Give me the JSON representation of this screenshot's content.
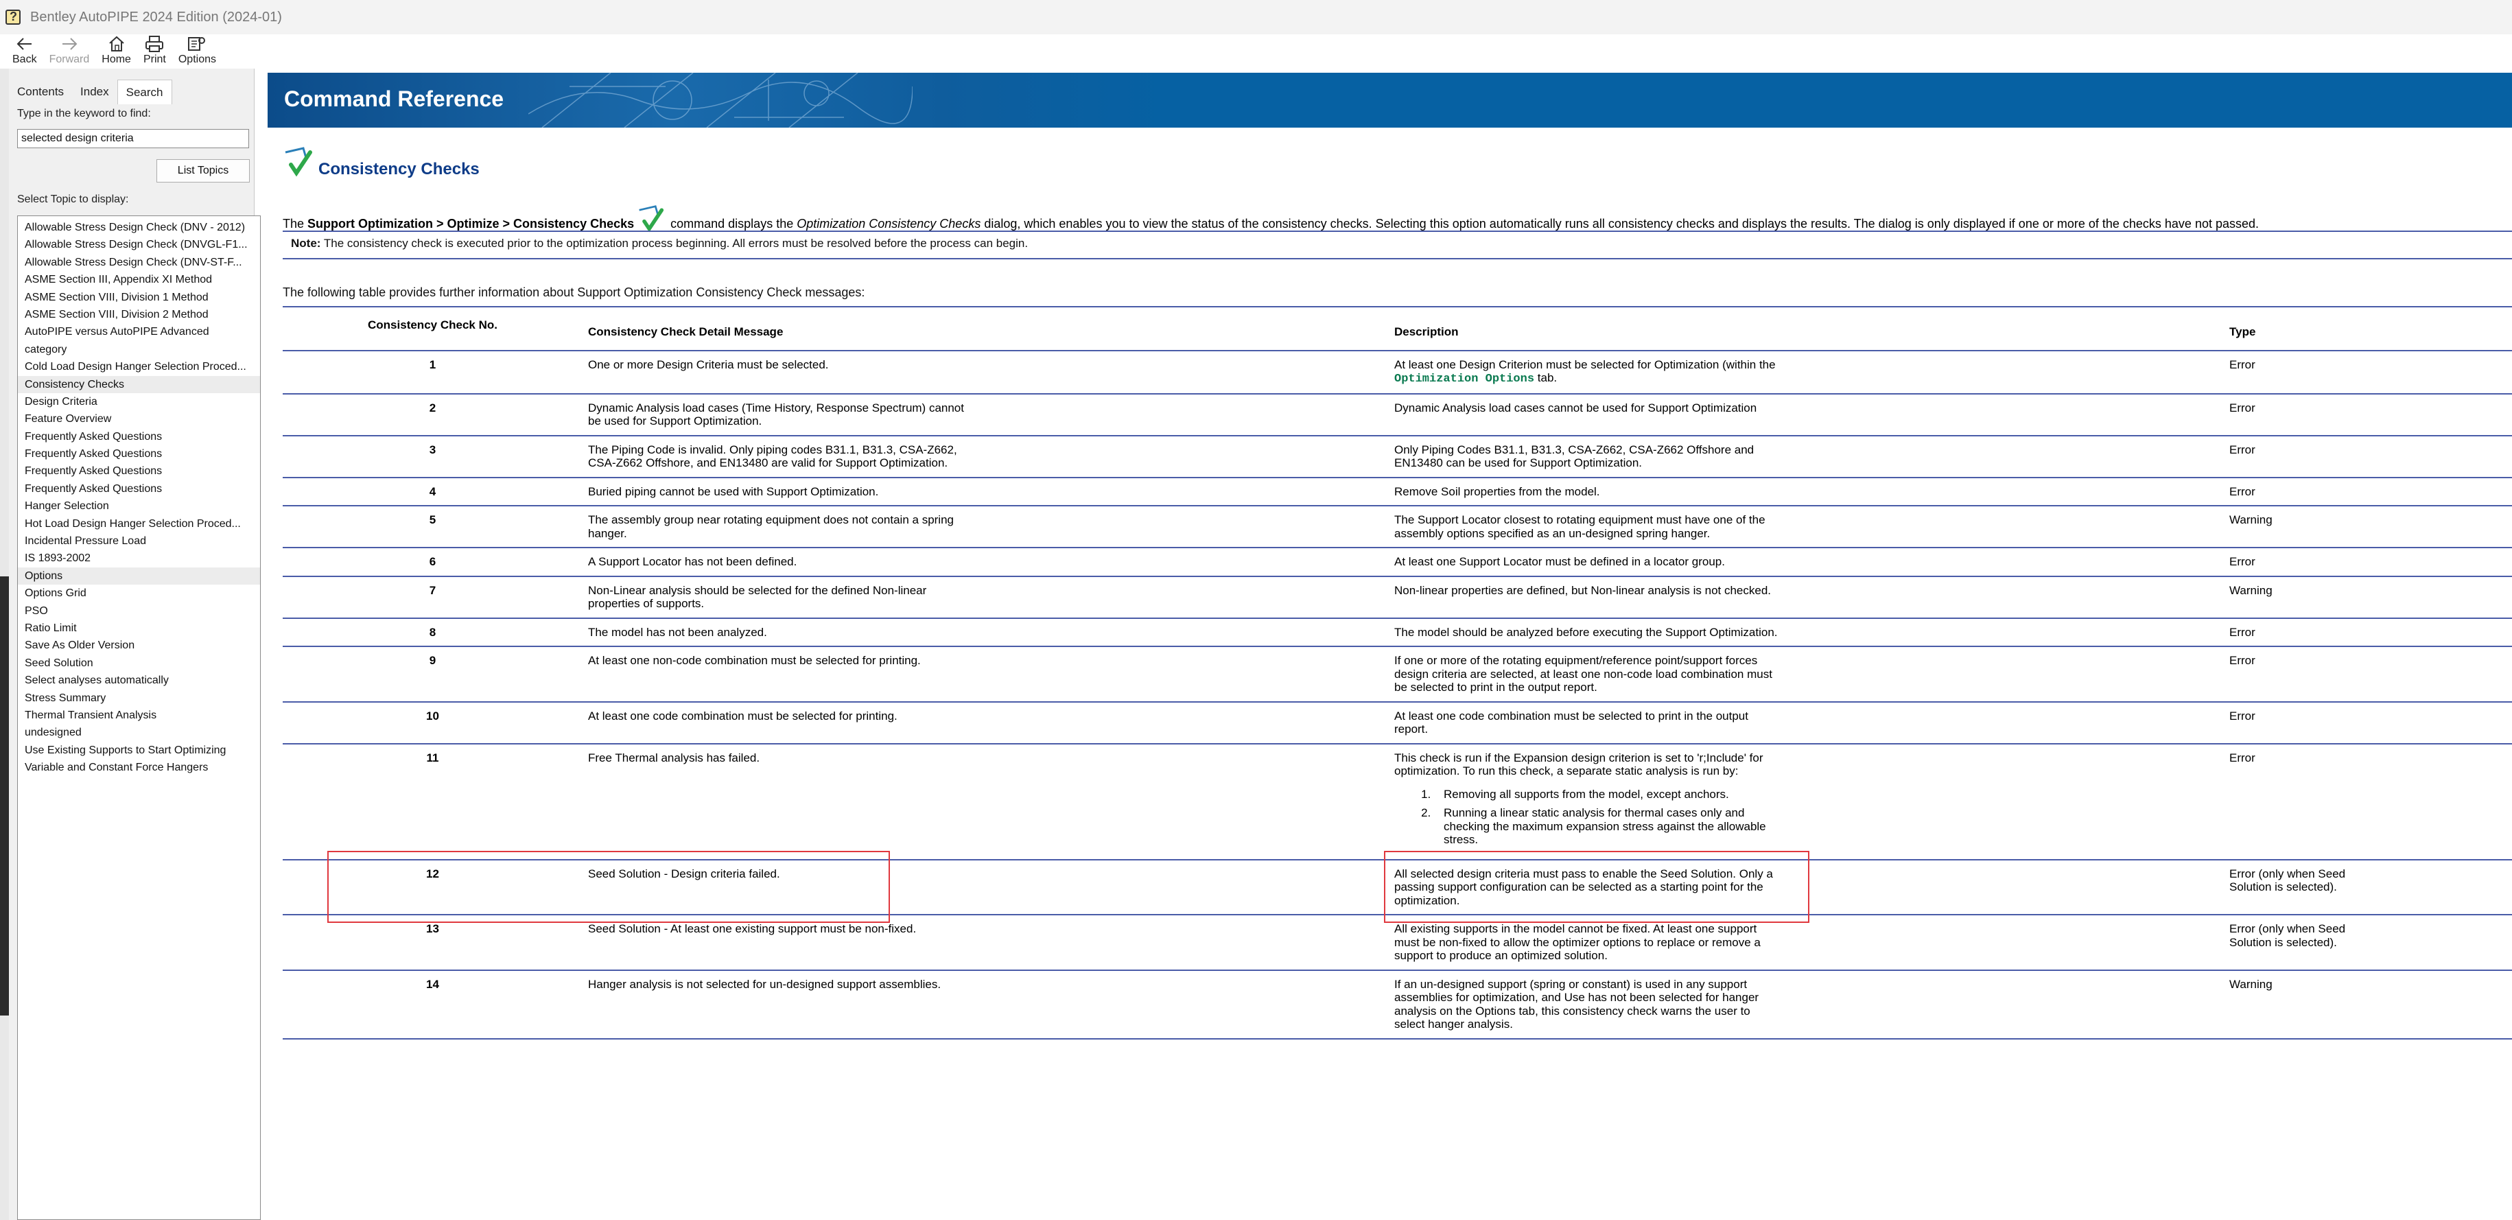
{
  "window": {
    "title": "Bentley AutoPIPE 2024 Edition (2024-01)",
    "icon": "help-book-icon"
  },
  "toolbar": {
    "buttons": [
      {
        "label": "Back",
        "icon": "back-arrow-icon",
        "enabled": true
      },
      {
        "label": "Forward",
        "icon": "forward-arrow-icon",
        "enabled": false
      },
      {
        "label": "Home",
        "icon": "home-icon",
        "enabled": true
      },
      {
        "label": "Print",
        "icon": "printer-icon",
        "enabled": true
      },
      {
        "label": "Options",
        "icon": "options-icon",
        "enabled": true
      }
    ]
  },
  "nav": {
    "tabs": [
      "Contents",
      "Index",
      "Search"
    ],
    "active_tab": "Search",
    "keyword_label": "Type in the keyword to find:",
    "search_value": "selected design criteria",
    "list_topics_label": "List Topics",
    "topic_label": "Select Topic to display:",
    "topics": [
      "Allowable Stress Design Check (DNV - 2012)",
      "Allowable Stress Design Check (DNVGL-F1...",
      "Allowable Stress Design Check (DNV-ST-F...",
      "ASME Section III, Appendix XI Method",
      "ASME Section VIII, Division 1 Method",
      "ASME Section VIII, Division 2 Method",
      "AutoPIPE versus AutoPIPE Advanced",
      "category",
      "Cold Load Design Hanger Selection Proced...",
      "Consistency Checks",
      "Design Criteria",
      "Feature Overview",
      "Frequently Asked Questions",
      "Frequently Asked Questions",
      "Frequently Asked Questions",
      "Frequently Asked Questions",
      "Hanger Selection",
      "Hot Load Design Hanger Selection Proced...",
      "Incidental Pressure Load",
      "IS 1893-2002",
      "Options",
      "Options Grid",
      "PSO",
      "Ratio Limit",
      "Save As Older Version",
      "Seed Solution",
      "Select analyses automatically",
      "Stress Summary",
      "Thermal Transient Analysis",
      "undesigned",
      "Use Existing Supports to Start Optimizing",
      "Variable and Constant Force Hangers"
    ],
    "highlighted_topics": [
      9,
      20
    ]
  },
  "content": {
    "banner_title": "Command Reference",
    "page_title": "Consistency Checks",
    "intro": {
      "prefix": "The ",
      "command": "Support Optimization > Optimize > Consistency Checks",
      "middle": " command displays the ",
      "dialog": "Optimization Consistency Checks",
      "suffix": " dialog, which enables you to view the status of the consistency checks. Selecting this option automatically runs all consistency checks and displays the results. The dialog is only displayed if one or more of the checks have not passed."
    },
    "note": {
      "label": "Note:",
      "text": " The consistency check is executed prior to the optimization process beginning. All errors must be resolved before the process can begin."
    },
    "table_intro": "The following table provides further information about Support Optimization Consistency Check messages:",
    "table": {
      "headers": [
        "Consistency Check No.",
        "Consistency Check Detail Message",
        "Description",
        "Type"
      ],
      "rows": [
        {
          "no": "1",
          "message": "One or more Design Criteria must be selected.",
          "desc_pre": "At least one Design Criterion must be selected for Optimization (within the ",
          "desc_link": "Optimization Options",
          "desc_post": " tab.",
          "type": "Error"
        },
        {
          "no": "2",
          "message": "Dynamic Analysis load cases (Time History, Response Spectrum) cannot be used for Support Optimization.",
          "desc_pre": "Dynamic Analysis load cases cannot be used for Support Optimization",
          "type": "Error"
        },
        {
          "no": "3",
          "message": "The Piping Code is invalid. Only piping codes B31.1, B31.3, CSA-Z662, CSA-Z662 Offshore, and EN13480 are valid for Support Optimization.",
          "desc_pre": "Only Piping Codes B31.1, B31.3, CSA-Z662, CSA-Z662 Offshore and EN13480 can be used for Support Optimization.",
          "type": "Error"
        },
        {
          "no": "4",
          "message": "Buried piping cannot be used with Support Optimization.",
          "desc_pre": "Remove Soil properties from the model.",
          "type": "Error"
        },
        {
          "no": "5",
          "message": "The assembly group near rotating equipment does not contain a spring hanger.",
          "desc_pre": "The Support Locator closest to rotating equipment must have one of the assembly options specified as an un-designed spring hanger.",
          "type": "Warning"
        },
        {
          "no": "6",
          "message": "A Support Locator has not been defined.",
          "desc_pre": "At least one Support Locator must be defined in a locator group.",
          "type": "Error"
        },
        {
          "no": "7",
          "message": "Non-Linear analysis should be selected for the defined Non-linear properties of supports.",
          "desc_pre": "Non-linear properties are defined, but Non-linear analysis is not checked.",
          "type": "Warning"
        },
        {
          "no": "8",
          "message": "The model has not been analyzed.",
          "desc_pre": "The model should be analyzed before executing the Support Optimization.",
          "type": "Error"
        },
        {
          "no": "9",
          "message": "At least one non-code combination must be selected for printing.",
          "desc_pre": "If one or more of the rotating equipment/reference point/support forces design criteria are selected, at least one non-code load combination must be selected to print in the output report.",
          "type": "Error"
        },
        {
          "no": "10",
          "message": "At least one code combination must be selected for printing.",
          "desc_pre": "At least one code combination must be selected to print in the output report.",
          "type": "Error"
        },
        {
          "no": "11",
          "message": "Free Thermal analysis has failed.",
          "desc_pre": "This check is run if the Expansion design criterion is set to 'r;Include' for optimization. To run this check, a separate static analysis is run by:",
          "desc_list": [
            "Removing all supports from the model, except anchors.",
            "Running a linear static analysis for thermal cases only and checking the maximum expansion stress against the allowable stress."
          ],
          "type": "Error"
        },
        {
          "no": "12",
          "message": "Seed Solution - Design criteria failed.",
          "desc_pre": "All selected design criteria must pass to enable the Seed Solution. Only a passing support configuration can be selected as a starting point for the optimization.",
          "type": "Error (only when Seed Solution is selected)."
        },
        {
          "no": "13",
          "message": "Seed Solution - At least one existing support must be non-fixed.",
          "desc_pre": "All existing supports in the model cannot be fixed. At least one support must be non-fixed to allow the optimizer options to replace or remove a support to produce an optimized solution.",
          "type": "Error (only when Seed Solution is selected)."
        },
        {
          "no": "14",
          "message": "Hanger analysis is not selected for un-designed support assemblies.",
          "desc_pre": "If an un-designed support (spring or constant) is used in any support assemblies for optimization, and Use has not been selected for hanger analysis on the Options tab, this consistency check warns the user to select hanger analysis.",
          "type": "Warning"
        }
      ]
    }
  },
  "colors": {
    "banner": "#0661a3",
    "title_blue": "#0e3c88",
    "rule": "#4a5ca8",
    "link_green": "#0a7a50",
    "highlight_box": "#e0383e"
  }
}
